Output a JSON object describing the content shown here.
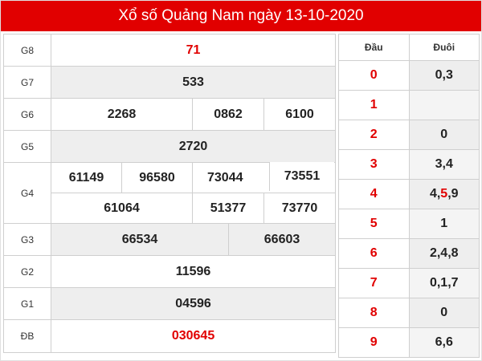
{
  "title": "Xổ số Quảng Nam ngày 13-10-2020",
  "prizes": {
    "g8": {
      "label": "G8",
      "numbers": [
        "71"
      ]
    },
    "g7": {
      "label": "G7",
      "numbers": [
        "533"
      ]
    },
    "g6": {
      "label": "G6",
      "numbers": [
        "2268",
        "0862",
        "6100"
      ]
    },
    "g5": {
      "label": "G5",
      "numbers": [
        "2720"
      ]
    },
    "g4": {
      "label": "G4",
      "numbers": [
        "61149",
        "96580",
        "73044",
        "73551",
        "61064",
        "51377",
        "73770"
      ]
    },
    "g3": {
      "label": "G3",
      "numbers": [
        "66534",
        "66603"
      ]
    },
    "g2": {
      "label": "G2",
      "numbers": [
        "11596"
      ]
    },
    "g1": {
      "label": "G1",
      "numbers": [
        "04596"
      ]
    },
    "db": {
      "label": "ĐB",
      "numbers": [
        "030645"
      ]
    }
  },
  "loto": {
    "head_label": "Đầu",
    "tail_label": "Đuôi",
    "rows": [
      {
        "head": "0",
        "tail": "0,3"
      },
      {
        "head": "1",
        "tail": ""
      },
      {
        "head": "2",
        "tail": "0"
      },
      {
        "head": "3",
        "tail": "3,4"
      },
      {
        "head": "4",
        "tail_parts": [
          "4,",
          "5",
          ",9"
        ]
      },
      {
        "head": "5",
        "tail": "1"
      },
      {
        "head": "6",
        "tail": "2,4,8"
      },
      {
        "head": "7",
        "tail": "0,1,7"
      },
      {
        "head": "8",
        "tail": "0"
      },
      {
        "head": "9",
        "tail": "6,6"
      }
    ]
  },
  "colors": {
    "accent": "#e10000",
    "shade": "#eeeeee",
    "border": "#cfcfcf"
  }
}
